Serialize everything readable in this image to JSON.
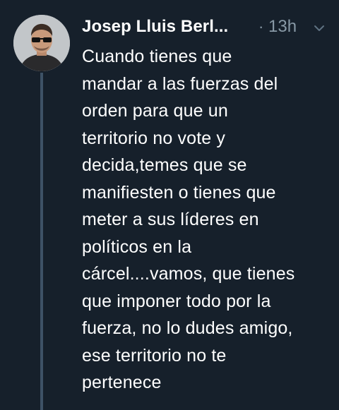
{
  "tweet": {
    "author_name": "Josep Lluis Berl...",
    "separator": "·",
    "timestamp": "13h",
    "menu_icon": "chevron-down-icon",
    "avatar_icon": "profile-photo",
    "text_lines": [
      "Cuando tienes que",
      "mandar a las fuerzas del",
      "orden para que un",
      "territorio no vote y",
      "decida,temes que se",
      "manifiesten o tienes que",
      "meter a sus líderes en",
      "políticos en la",
      "cárcel....vamos, que tienes",
      "que imponer todo por la",
      "fuerza, no lo dudes amigo,",
      "ese territorio no te",
      "pertenece"
    ]
  },
  "colors": {
    "background": "#16202b",
    "text": "#ffffff",
    "muted": "#8899a6",
    "thread_line": "#3e5266"
  }
}
